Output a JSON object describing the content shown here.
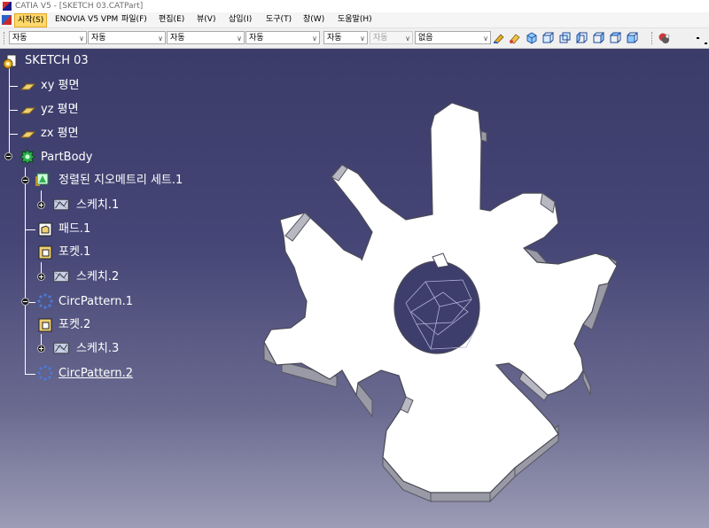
{
  "window": {
    "title": "CATIA V5 - [SKETCH 03.CATPart]"
  },
  "menu": {
    "items": [
      {
        "label": "시작(S)"
      },
      {
        "label": "ENOVIA V5 VPM"
      },
      {
        "label": "파일(F)"
      },
      {
        "label": "편집(E)"
      },
      {
        "label": "뷰(V)"
      },
      {
        "label": "삽입(I)"
      },
      {
        "label": "도구(T)"
      },
      {
        "label": "창(W)"
      },
      {
        "label": "도움말(H)"
      }
    ]
  },
  "toolbar": {
    "dropdowns": [
      {
        "value": "자동"
      },
      {
        "value": "자동"
      },
      {
        "value": "자동"
      },
      {
        "value": "자동"
      },
      {
        "value": "자동"
      },
      {
        "value": "자동",
        "disabled": true
      },
      {
        "value": "없음"
      }
    ],
    "icons": [
      "paint-icon",
      "eraser-icon",
      "cube-iso-icon",
      "cube-front-icon",
      "cube-back-icon",
      "cube-left-icon",
      "cube-right-icon",
      "cube-top-icon",
      "cube-bottom-icon",
      "render-style-icon",
      "more-icon"
    ]
  },
  "tree": {
    "root": {
      "label": "SKETCH 03"
    },
    "planes": [
      {
        "label": "xy 평면"
      },
      {
        "label": "yz 평면"
      },
      {
        "label": "zx 평면"
      }
    ],
    "body": {
      "label": "PartBody"
    },
    "geom_set": {
      "label": "정렬된 지오메트리 세트.1"
    },
    "sketch1": {
      "label": "스케치.1"
    },
    "pad": {
      "label": "패드.1"
    },
    "pocket1": {
      "label": "포켓.1"
    },
    "sketch2": {
      "label": "스케치.2"
    },
    "circ1": {
      "label": "CircPattern.1"
    },
    "pocket2": {
      "label": "포켓.2"
    },
    "sketch3": {
      "label": "스케치.3"
    },
    "circ2": {
      "label": "CircPattern.2"
    }
  },
  "colors": {
    "viewport_top": "#3c3c6a",
    "viewport_bottom": "#9c9cb6",
    "part_face": "#ffffff",
    "part_side": "#9a9aa6",
    "tree_text": "#ffffff",
    "highlight": "#ffd86b"
  }
}
